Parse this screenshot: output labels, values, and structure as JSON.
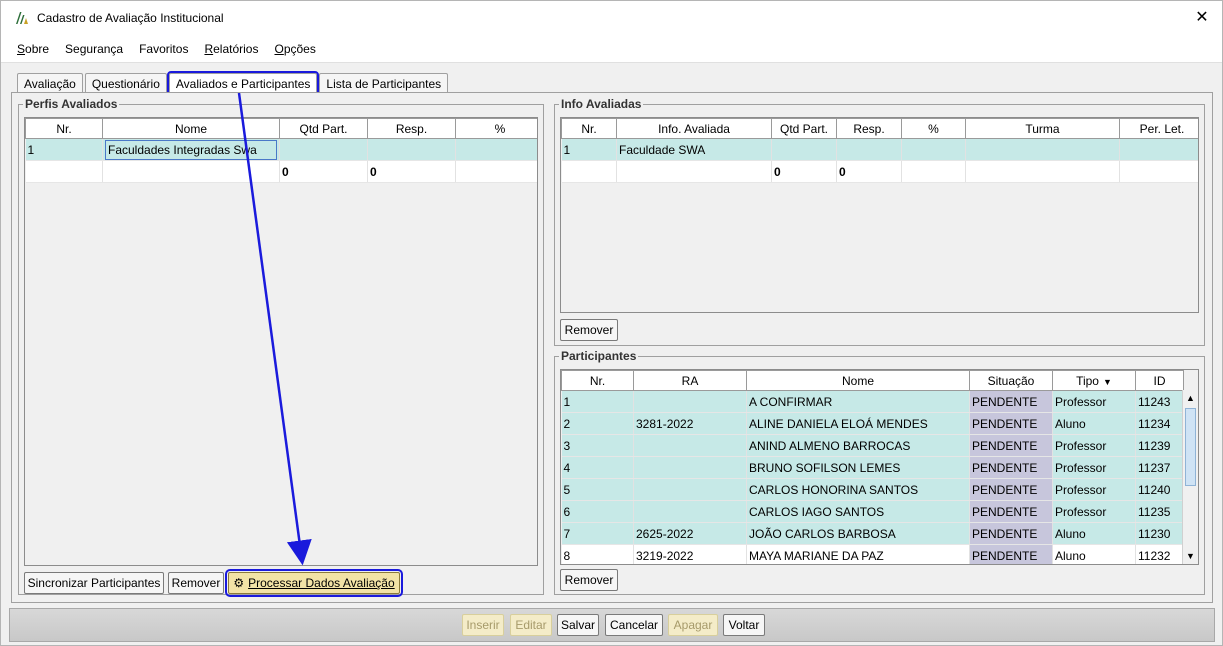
{
  "window": {
    "title": "Cadastro de Avaliação Institucional"
  },
  "menu": [
    {
      "pre": "",
      "u": "S",
      "post": "obre"
    },
    {
      "pre": "",
      "u": "",
      "post": "Segurança"
    },
    {
      "pre": "",
      "u": "",
      "post": "Favoritos"
    },
    {
      "pre": "",
      "u": "R",
      "post": "elatórios"
    },
    {
      "pre": "",
      "u": "O",
      "post": "pções"
    }
  ],
  "tabs": [
    "Avaliação",
    "Questionário",
    "Avaliados e Participantes",
    "Lista de Participantes"
  ],
  "perfis": {
    "title": "Perfis Avaliados",
    "columns": [
      "Nr.",
      "Nome",
      "Qtd Part.",
      "Resp.",
      "%"
    ],
    "rows": [
      {
        "nr": "1",
        "nome": "Faculdades Integradas Swa",
        "qtd": "",
        "resp": "",
        "pct": ""
      }
    ],
    "totals": {
      "qtd": "0",
      "resp": "0"
    },
    "buttons": {
      "sync": "Sincronizar Participantes",
      "remove": "Remover",
      "process": "Processar Dados Avaliação"
    }
  },
  "info": {
    "title": "Info Avaliadas",
    "columns": [
      "Nr.",
      "Info. Avaliada",
      "Qtd Part.",
      "Resp.",
      "%",
      "Turma",
      "Per. Let."
    ],
    "rows": [
      {
        "nr": "1",
        "info": "Faculdade SWA",
        "qtd": "",
        "resp": "",
        "pct": "",
        "turma": "",
        "per": ""
      }
    ],
    "totals": {
      "qtd": "0",
      "resp": "0"
    },
    "remove": "Remover"
  },
  "participantes": {
    "title": "Participantes",
    "columns": [
      "Nr.",
      "RA",
      "Nome",
      "Situação",
      "Tipo",
      "ID"
    ],
    "rows": [
      {
        "nr": "1",
        "ra": "",
        "nome": "A CONFIRMAR",
        "sit": "PENDENTE",
        "tipo": "Professor",
        "id": "11243"
      },
      {
        "nr": "2",
        "ra": "3281-2022",
        "nome": "ALINE DANIELA ELOÁ MENDES",
        "sit": "PENDENTE",
        "tipo": "Aluno",
        "id": "11234"
      },
      {
        "nr": "3",
        "ra": "",
        "nome": "ANIND ALMENO BARROCAS",
        "sit": "PENDENTE",
        "tipo": "Professor",
        "id": "11239"
      },
      {
        "nr": "4",
        "ra": "",
        "nome": "BRUNO SOFILSON LEMES",
        "sit": "PENDENTE",
        "tipo": "Professor",
        "id": "11237"
      },
      {
        "nr": "5",
        "ra": "",
        "nome": "CARLOS HONORINA SANTOS",
        "sit": "PENDENTE",
        "tipo": "Professor",
        "id": "11240"
      },
      {
        "nr": "6",
        "ra": "",
        "nome": "CARLOS IAGO SANTOS",
        "sit": "PENDENTE",
        "tipo": "Professor",
        "id": "11235"
      },
      {
        "nr": "7",
        "ra": "2625-2022",
        "nome": "JOÃO CARLOS BARBOSA",
        "sit": "PENDENTE",
        "tipo": "Aluno",
        "id": "11230"
      },
      {
        "nr": "8",
        "ra": "3219-2022",
        "nome": "MAYA MARIANE DA PAZ",
        "sit": "PENDENTE",
        "tipo": "Aluno",
        "id": "11232"
      }
    ],
    "remove": "Remover"
  },
  "bottom_buttons": {
    "inserir": "Inserir",
    "editar": "Editar",
    "salvar": "Salvar",
    "cancelar": "Cancelar",
    "apagar": "Apagar",
    "voltar": "Voltar"
  },
  "colors": {
    "selected_row": "#c6e9e7",
    "situacao_cell": "#c7c6dc",
    "highlight": "#1a1adc",
    "primary_button": "#f2e3a6"
  }
}
